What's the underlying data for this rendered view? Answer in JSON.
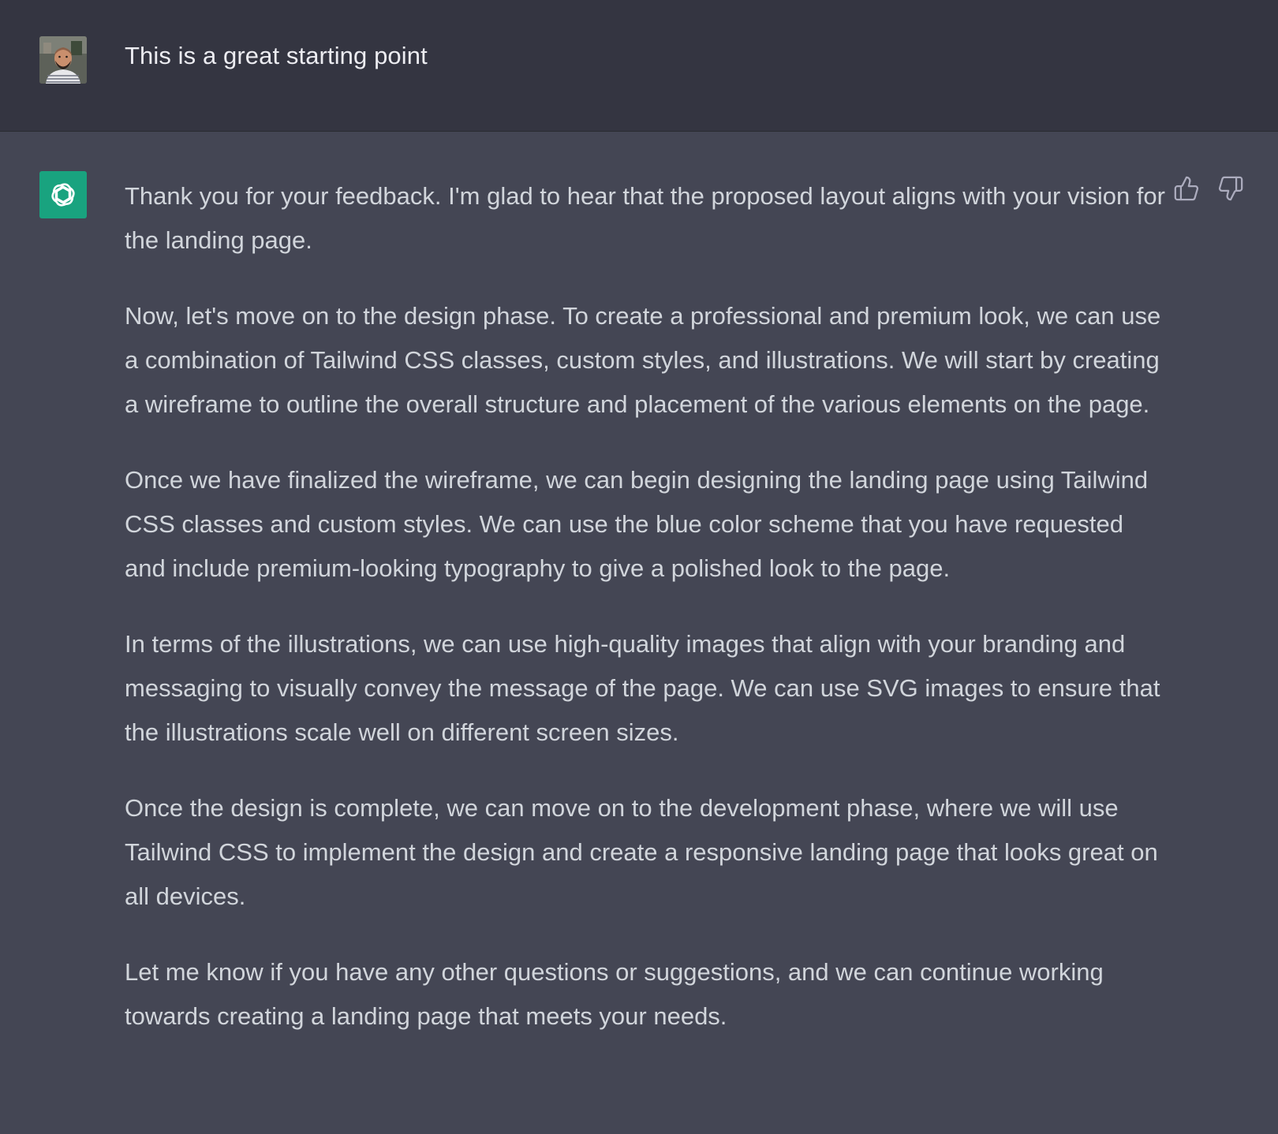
{
  "user_message": {
    "text": "This is a great starting point",
    "avatar_icon": "user-avatar-photo"
  },
  "assistant_message": {
    "avatar_icon": "openai-logo-icon",
    "accent_color": "#19a37f",
    "paragraphs": [
      "Thank you for your feedback. I'm glad to hear that the proposed layout aligns with your vision for the landing page.",
      "Now, let's move on to the design phase. To create a professional and premium look, we can use a combination of Tailwind CSS classes, custom styles, and illustrations. We will start by creating a wireframe to outline the overall structure and placement of the various elements on the page.",
      "Once we have finalized the wireframe, we can begin designing the landing page using Tailwind CSS classes and custom styles. We can use the blue color scheme that you have requested and include premium-looking typography to give a polished look to the page.",
      "In terms of the illustrations, we can use high-quality images that align with your branding and messaging to visually convey the message of the page. We can use SVG images to ensure that the illustrations scale well on different screen sizes.",
      "Once the design is complete, we can move on to the development phase, where we will use Tailwind CSS to implement the design and create a responsive landing page that looks great on all devices.",
      "Let me know if you have any other questions or suggestions, and we can continue working towards creating a landing page that meets your needs."
    ],
    "feedback": {
      "like_icon": "thumbs-up-icon",
      "dislike_icon": "thumbs-down-icon"
    }
  }
}
